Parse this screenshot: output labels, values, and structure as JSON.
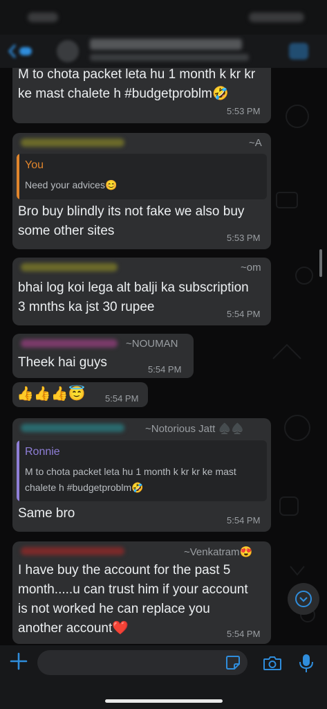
{
  "colors": {
    "accent": "#2f8ddc",
    "bubble": "#2e2f31",
    "quote_you": "#e0852c",
    "quote_ronnie": "#8f7fd8"
  },
  "icons": {
    "back": "chevron-left-icon",
    "call": "phone-icon",
    "add": "plus-icon",
    "sticker": "sticker-icon",
    "camera": "camera-icon",
    "mic": "microphone-icon",
    "scroll": "chevron-down-icon"
  },
  "messages": [
    {
      "lines": [
        "M to chota packet leta hu 1 month k kr kr",
        "ke mast chalete h #budgetproblm🤣"
      ],
      "time": "5:53 PM"
    },
    {
      "handle": "~A",
      "quote": {
        "author": "You",
        "lines": [
          "Need your advices😊"
        ]
      },
      "lines": [
        "Bro buy blindly its not fake we also buy",
        "some other sites"
      ],
      "time": "5:53 PM"
    },
    {
      "handle": "~om",
      "lines": [
        "bhai log koi lega alt balji ka subscription",
        "3 mnths ka jst 30 rupee"
      ],
      "time": "5:54 PM"
    },
    {
      "handle": "~NOUMAN",
      "lines": [
        "Theek hai guys"
      ],
      "time": "5:54 PM"
    },
    {
      "lines": [
        "👍👍👍😇"
      ],
      "time": "5:54 PM"
    },
    {
      "handle": "~Notorious Jatt ♠️♠️",
      "quote": {
        "author": "Ronnie",
        "lines": [
          "M to chota packet leta hu 1 month k kr kr ke mast",
          "chalete h #budgetproblm🤣"
        ]
      },
      "lines": [
        "Same bro"
      ],
      "time": "5:54 PM"
    },
    {
      "handle": "~Venkatram😍",
      "lines": [
        "I have buy the account for the past 5",
        "month.....u can trust him if your account",
        "is not worked he can replace you",
        "another account❤️"
      ],
      "time": "5:54 PM"
    }
  ]
}
